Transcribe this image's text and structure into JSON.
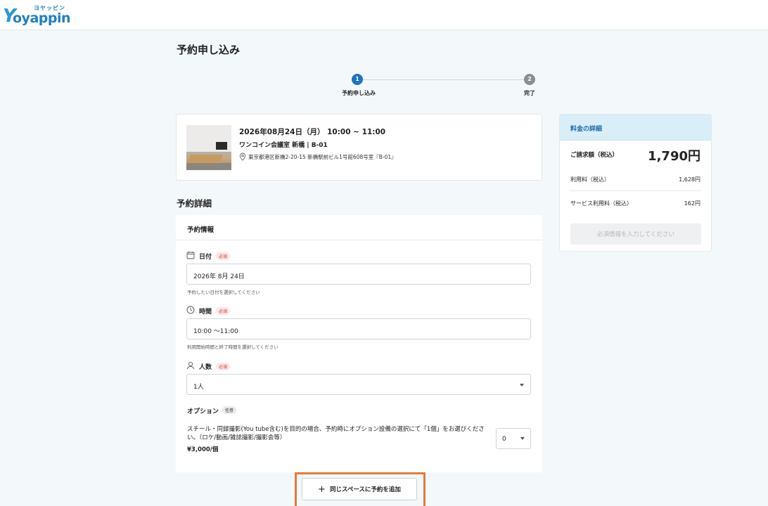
{
  "brand": {
    "kana": "ヨヤッピン",
    "logo_y": "Y",
    "logo_text": "oyappin"
  },
  "page": {
    "title": "予約申し込み"
  },
  "stepper": {
    "steps": [
      {
        "number": "1",
        "label": "予約申し込み"
      },
      {
        "number": "2",
        "label": "完了"
      }
    ]
  },
  "booking": {
    "datetime": "2026年08月24日（月） 10:00 ~ 11:00",
    "room": "ワンコイン会議室 新橋 | B-01",
    "address": "東京都港区新橋2-20-15 新橋駅前ビル1号館608号室『B-01』"
  },
  "details": {
    "section_title": "予約詳細",
    "card_title": "予約情報",
    "required_badge": "必須",
    "optional_badge": "任意",
    "date": {
      "label": "日付",
      "value": "2026年 8月 24日",
      "hint": "予約したい日付を選択してください"
    },
    "time": {
      "label": "時間",
      "value": "10:00 ～11:00",
      "hint": "利用開始時間と終了時間を選択してください"
    },
    "people": {
      "label": "人数",
      "value": "1人"
    },
    "options": {
      "label": "オプション",
      "description": "スチール・同録撮影(You tube含む)を目的の場合、予約時にオプション設備の選択にて「1個」をお選びください。（ロケ/動画/雑誌撮影/撮影会等）",
      "price": "¥3,000/個",
      "quantity": "0"
    },
    "add_button": "同じスペースに予約を追加"
  },
  "price": {
    "title": "料金の詳細",
    "total_label": "ご請求額（税込）",
    "total_value": "1,790円",
    "rows": [
      {
        "label": "利用料（税込）",
        "value": "1,628円"
      },
      {
        "label": "サービス利用料（税込）",
        "value": "162円"
      }
    ],
    "submit": "必須情報を入力してください"
  },
  "colors": {
    "accent": "#1c73c5",
    "highlight": "#e8793a",
    "required": "#d23b3b"
  }
}
